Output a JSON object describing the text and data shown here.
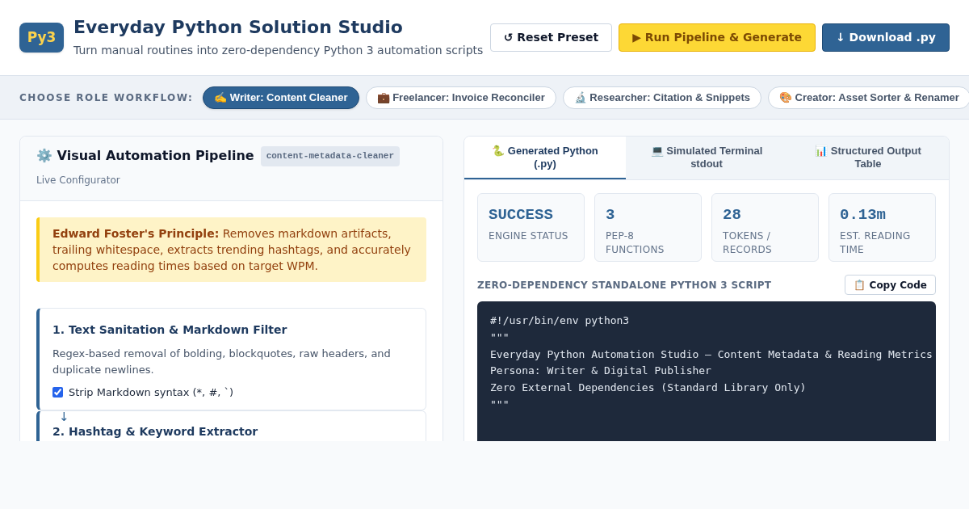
{
  "header": {
    "logo": "Py3",
    "title": "Everyday Python Solution Studio",
    "subtitle": "Turn manual routines into zero-dependency Python 3 automation scripts",
    "buttons": [
      {
        "kind": "outline",
        "label": "↺ Reset Preset"
      },
      {
        "kind": "accent",
        "label": "▶ Run Pipeline & Generate"
      },
      {
        "kind": "primary",
        "label": "↓ Download .py"
      }
    ]
  },
  "roles": {
    "label": "CHOOSE ROLE WORKFLOW:",
    "items": [
      {
        "label": "✍️ Writer: Content Cleaner",
        "selected": true
      },
      {
        "label": "💼 Freelancer: Invoice Reconciler",
        "selected": false
      },
      {
        "label": "🔬 Researcher: Citation & Snippets",
        "selected": false
      },
      {
        "label": "🎨 Creator: Asset Sorter & Renamer",
        "selected": false
      }
    ]
  },
  "pipeline": {
    "title": "⚙️ Visual Automation Pipeline",
    "badge": "content-metadata-cleaner",
    "subtitle": "Live Configurator",
    "note": "**Edward Foster's Principle:** Removes markdown artifacts, trailing whitespace, extracts trending hashtags, and accurately computes reading times based on target WPM.",
    "steps": [
      {
        "title": "1. Text Sanitation & Markdown Filter",
        "description": "Regex-based removal of bolding, blockquotes, raw headers, and duplicate newlines.",
        "option": {
          "label": "Strip Markdown syntax (*, #, `)",
          "checked": true
        }
      },
      {
        "arrow": "↓",
        "title": "2. Hashtag & Keyword Extractor"
      }
    ]
  },
  "output": {
    "tabs": [
      {
        "label": "🐍 Generated Python (.py)",
        "selected": true
      },
      {
        "label": "💻 Simulated Terminal stdout",
        "selected": false
      },
      {
        "label": "📊 Structured Output Table",
        "selected": false
      }
    ],
    "stats": [
      {
        "value": "SUCCESS",
        "label": "ENGINE STATUS"
      },
      {
        "value": "3",
        "label": "PEP-8 FUNCTIONS"
      },
      {
        "value": "28",
        "label": "TOKENS / RECORDS"
      },
      {
        "value": "0.13m",
        "label": "EST. READING TIME"
      }
    ],
    "script_title": "ZERO-DEPENDENCY STANDALONE PYTHON 3 SCRIPT",
    "copy_button": "📋 Copy Code",
    "code": [
      "#!/usr/bin/env python3",
      "\"\"\"",
      "Everyday Python Automation Studio — Content Metadata & Reading Metrics",
      "Persona: Writer & Digital Publisher",
      "Zero External Dependencies (Standard Library Only)",
      "\"\"\""
    ]
  }
}
